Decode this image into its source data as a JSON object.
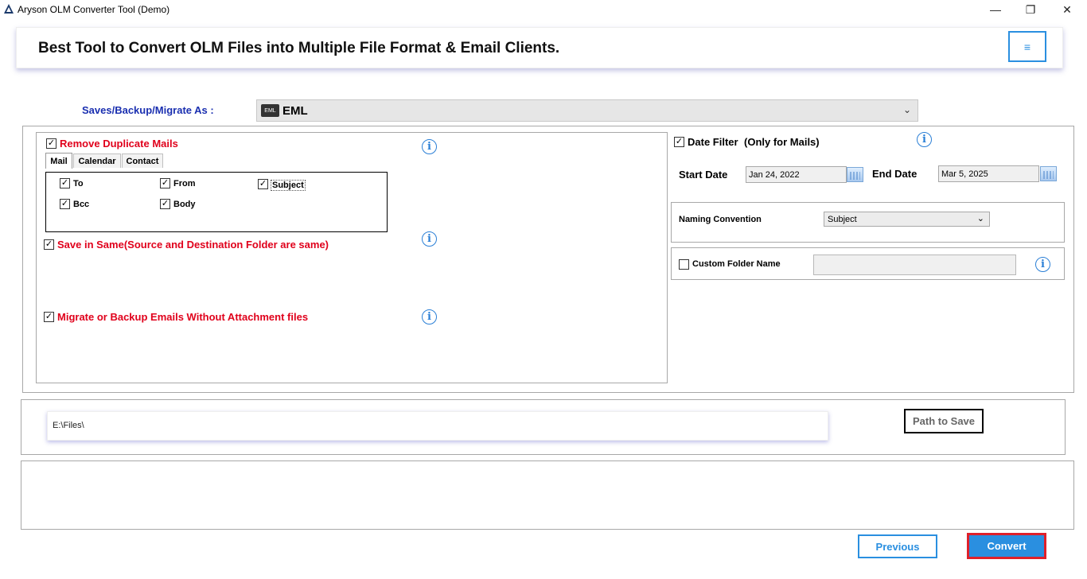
{
  "window": {
    "title": "Aryson OLM Converter Tool (Demo)",
    "minimize": "—",
    "maximize": "❐",
    "close": "✕"
  },
  "banner": {
    "title": "Best Tool to Convert OLM Files into Multiple File Format & Email Clients.",
    "menu_icon": "≡"
  },
  "saves": {
    "label": "Saves/Backup/Migrate As :",
    "badge": "EML",
    "value": "EML",
    "chevron": "⌄"
  },
  "options": {
    "remove_duplicates": {
      "label": "Remove Duplicate Mails",
      "checked": true
    },
    "tabs": [
      {
        "label": "Mail",
        "active": true
      },
      {
        "label": "Calendar",
        "active": false
      },
      {
        "label": "Contact",
        "active": false
      }
    ],
    "mail_fields": {
      "to": {
        "label": "To",
        "checked": true
      },
      "from": {
        "label": "From",
        "checked": true
      },
      "subject": {
        "label": "Subject",
        "checked": true
      },
      "bcc": {
        "label": "Bcc",
        "checked": true
      },
      "body": {
        "label": "Body",
        "checked": true
      }
    },
    "save_in_same": {
      "label": "Save in Same(Source and Destination Folder are same)",
      "checked": true
    },
    "without_attachments": {
      "label": "Migrate or Backup Emails Without Attachment files",
      "checked": true
    }
  },
  "date_filter": {
    "label": "Date Filter",
    "note": "(Only for Mails)",
    "checked": true,
    "start_label": "Start Date",
    "start_value": "Jan 24, 2022",
    "end_label": "End Date",
    "end_value": "Mar 5, 2025"
  },
  "naming": {
    "label": "Naming Convention",
    "value": "Subject",
    "chevron": "⌄"
  },
  "custom_folder": {
    "label": "Custom Folder Name",
    "checked": false,
    "value": ""
  },
  "path": {
    "value": "E:\\Files\\",
    "button": "Path to Save"
  },
  "footer": {
    "previous": "Previous",
    "convert": "Convert"
  },
  "icons": {
    "check": "✓",
    "info": "i"
  },
  "colors": {
    "accent_blue": "#2a8fe0",
    "label_red": "#e0001b",
    "label_navy": "#1a2fb0",
    "convert_border": "#e0202a"
  }
}
